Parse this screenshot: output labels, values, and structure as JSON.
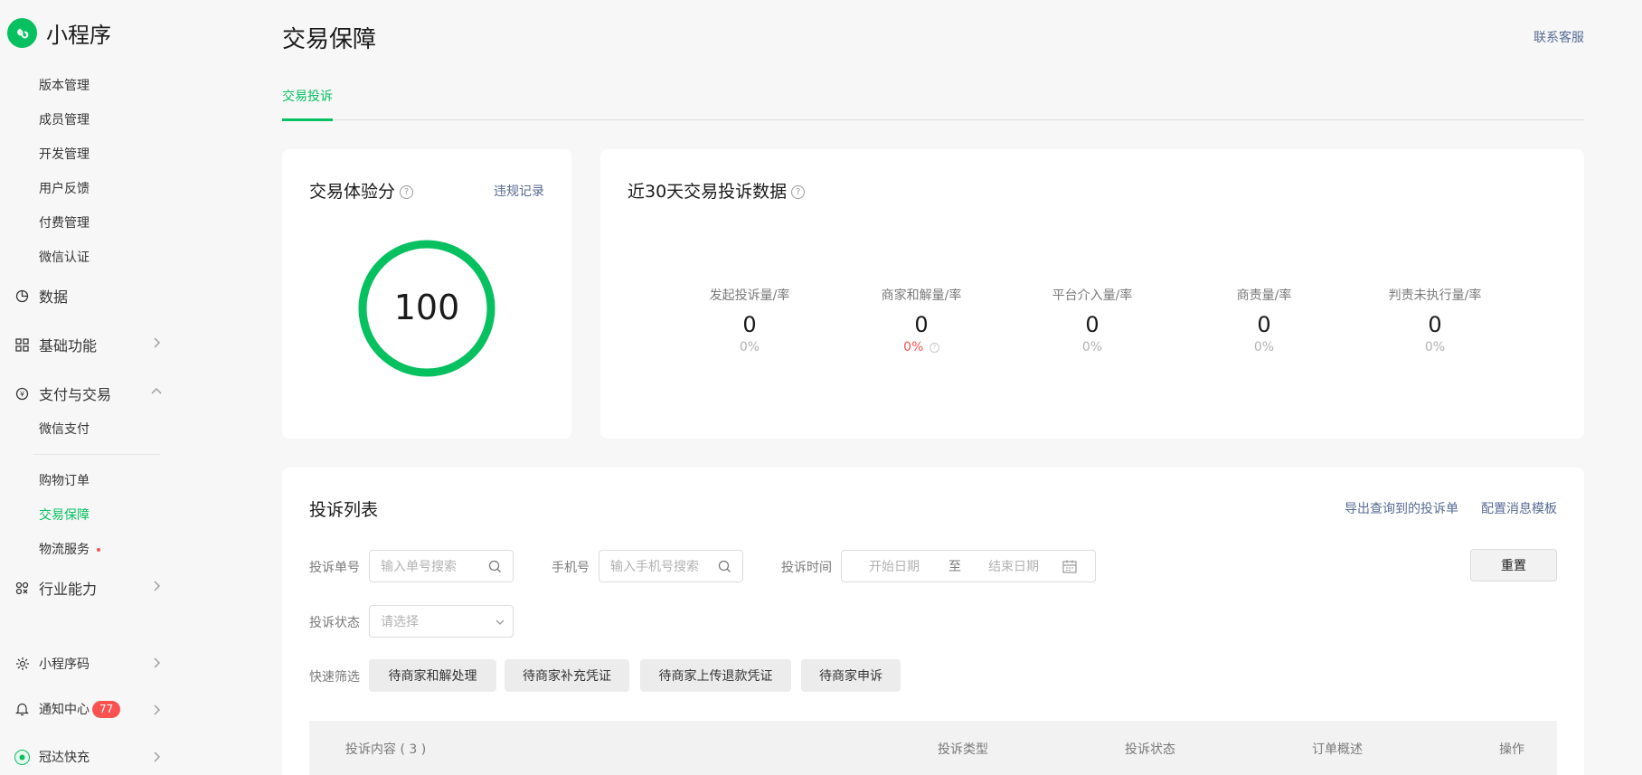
{
  "brand": {
    "name": "小程序"
  },
  "sidebar": {
    "sub_items_top": [
      "版本管理",
      "成员管理",
      "开发管理",
      "用户反馈",
      "付费管理",
      "微信认证"
    ],
    "groups": {
      "data": "数据",
      "basic": "基础功能",
      "pay": "支付与交易",
      "industry": "行业能力",
      "qrcode": "小程序码",
      "notify": "通知中心",
      "account": "冠达快充"
    },
    "pay_items": [
      "微信支付",
      "购物订单",
      "交易保障",
      "物流服务"
    ],
    "notify_badge": "77"
  },
  "header": {
    "title": "交易保障",
    "contact": "联系客服",
    "tab": "交易投诉"
  },
  "score_card": {
    "title": "交易体验分",
    "link": "违规记录",
    "score": "100",
    "score_fraction": 1.0,
    "ring_color": "#07c160"
  },
  "stats_card": {
    "title": "近30天交易投诉数据",
    "stats": [
      {
        "label": "发起投诉量/率",
        "value": "0",
        "pct": "0%"
      },
      {
        "label": "商家和解量/率",
        "value": "0",
        "pct": "0%"
      },
      {
        "label": "平台介入量/率",
        "value": "0",
        "pct": "0%"
      },
      {
        "label": "商责量/率",
        "value": "0",
        "pct": "0%"
      },
      {
        "label": "判责未执行量/率",
        "value": "0",
        "pct": "0%"
      }
    ]
  },
  "list": {
    "title": "投诉列表",
    "export": "导出查询到的投诉单",
    "config": "配置消息模板",
    "filters": {
      "order_label": "投诉单号",
      "order_placeholder": "输入单号搜索",
      "phone_label": "手机号",
      "phone_placeholder": "输入手机号搜索",
      "time_label": "投诉时间",
      "start": "开始日期",
      "to": "至",
      "end": "结束日期",
      "reset": "重置",
      "status_label": "投诉状态",
      "status_placeholder": "请选择",
      "quick_label": "快速筛选",
      "quick": [
        "待商家和解处理",
        "待商家补充凭证",
        "待商家上传退款凭证",
        "待商家申诉"
      ]
    },
    "columns": [
      "投诉内容 ( 3 )",
      "投诉类型",
      "投诉状态",
      "订单概述",
      "操作"
    ]
  },
  "colors": {
    "accent": "#07c160",
    "link": "#576b95",
    "danger": "#fa5151"
  }
}
